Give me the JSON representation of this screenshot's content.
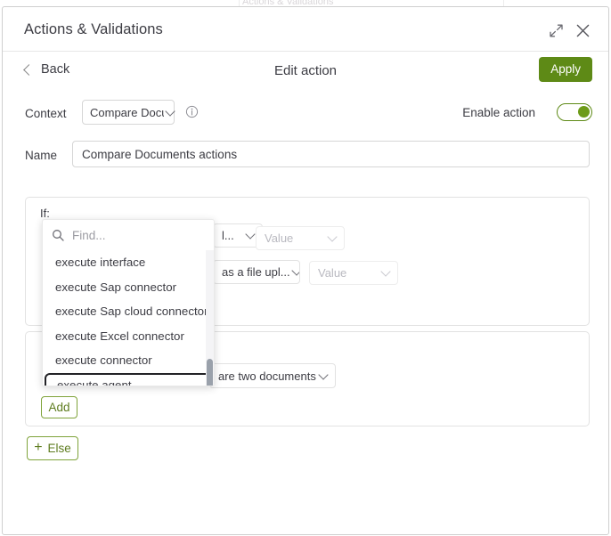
{
  "background": {
    "title": "Actions & Validations"
  },
  "modal": {
    "title": "Actions & Validations",
    "expand_icon": "expand-icon",
    "close_icon": "close-icon"
  },
  "subheader": {
    "back_label": "Back",
    "title": "Edit action",
    "apply_label": "Apply"
  },
  "context": {
    "label": "Context",
    "value": "Compare Docu",
    "info_icon": "info-icon",
    "enable_label": "Enable action",
    "enable_state": "on"
  },
  "name": {
    "label": "Name",
    "value": "Compare Documents actions"
  },
  "if_card": {
    "label": "If:",
    "row1": {
      "type_value": "l...",
      "value_placeholder": "Value"
    },
    "row2": {
      "type_value": "as a file upl...",
      "value_placeholder": "Value"
    }
  },
  "then_card": {
    "select_value": "are two documents",
    "add_label": "Add"
  },
  "else_button": {
    "plus": "+",
    "label": "Else"
  },
  "dropdown": {
    "search_placeholder": "Find...",
    "search_value": "",
    "search_icon": "search-icon",
    "items": [
      {
        "label": "execute interface",
        "focused": false
      },
      {
        "label": "execute Sap connector",
        "focused": false
      },
      {
        "label": "execute Sap cloud connector",
        "focused": false
      },
      {
        "label": "execute Excel connector",
        "focused": false
      },
      {
        "label": "execute connector",
        "focused": false
      },
      {
        "label": "execute agent",
        "focused": true
      }
    ]
  },
  "colors": {
    "accent_green": "#5e8a16",
    "outline_green": "#7fa33a",
    "text": "#3c3c43",
    "muted": "#b9b9c0"
  }
}
